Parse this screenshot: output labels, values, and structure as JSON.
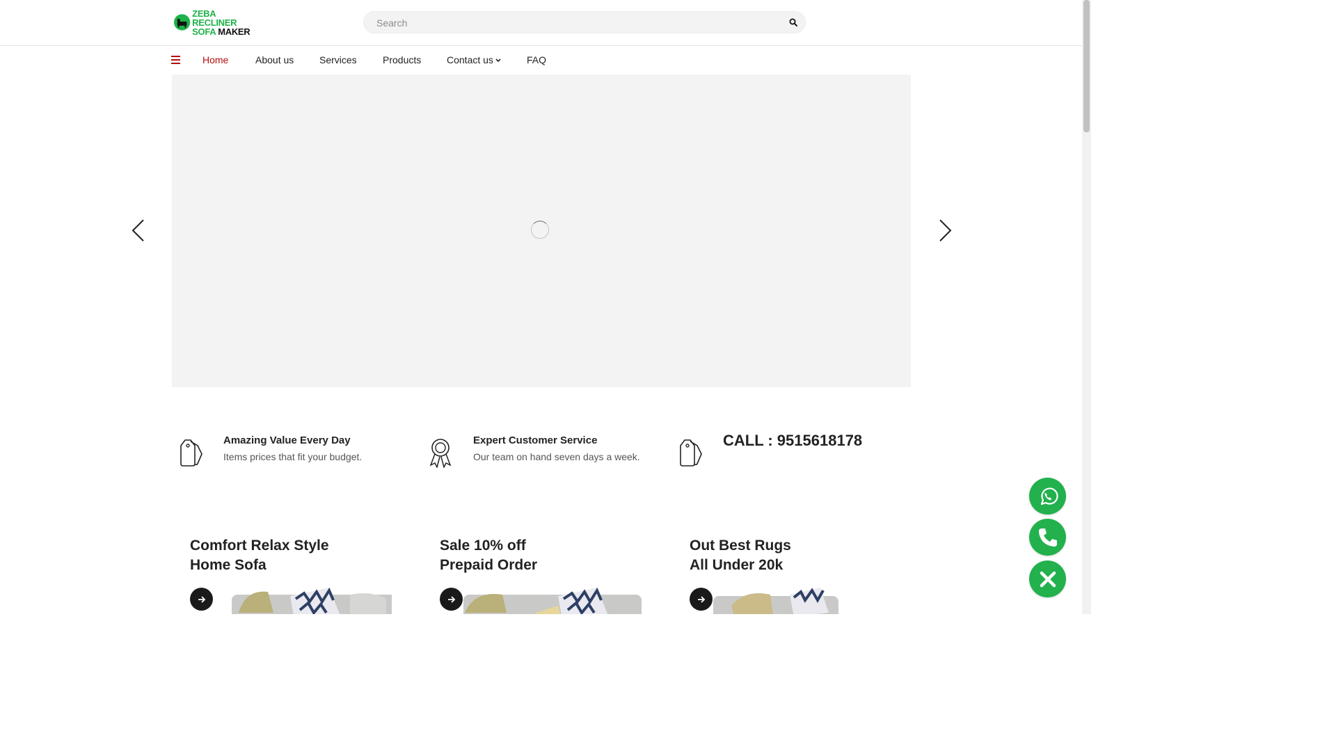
{
  "logo": {
    "line1": "ZEBA RECLINER",
    "line2_white": "SOFA ",
    "line2_black": "MAKER"
  },
  "search": {
    "placeholder": "Search",
    "value": ""
  },
  "nav": {
    "items": [
      {
        "label": "Home",
        "active": true
      },
      {
        "label": "About us"
      },
      {
        "label": "Services"
      },
      {
        "label": "Products"
      },
      {
        "label": "Contact us",
        "has_dropdown": true
      },
      {
        "label": "FAQ"
      }
    ]
  },
  "features": [
    {
      "title": "Amazing Value Every Day",
      "subtitle": "Items prices that fit your budget.",
      "icon": "price-tag-icon"
    },
    {
      "title": "Expert Customer Service",
      "subtitle": "Our team on hand seven days a week.",
      "icon": "award-ribbon-icon"
    },
    {
      "title": "CALL : 9515618178",
      "icon": "price-tag-icon"
    }
  ],
  "promos": [
    {
      "line1": "Comfort Relax Style",
      "line2": "Home Sofa"
    },
    {
      "line1": "Sale 10% off",
      "line2": "Prepaid Order"
    },
    {
      "line1": "Out Best Rugs",
      "line2": "All Under 20k"
    }
  ],
  "floating": [
    {
      "icon": "whatsapp-icon"
    },
    {
      "icon": "phone-icon"
    },
    {
      "icon": "close-icon"
    }
  ],
  "colors": {
    "accent_red": "#b50d0d",
    "brand_green": "#22b14c",
    "slider_bg": "#f3f3f3"
  }
}
